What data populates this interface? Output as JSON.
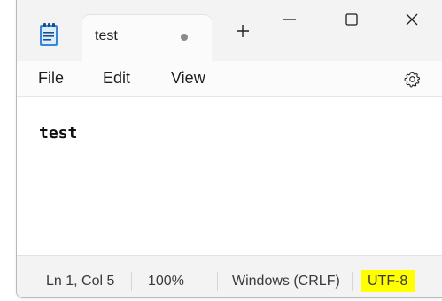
{
  "app": {
    "tab_title": "test",
    "tab_unsaved_indicator": "dot",
    "icon": "notepad-icon",
    "accent_color": "#3a86d6"
  },
  "window_controls": {
    "new_tab_icon": "plus-icon",
    "minimize_icon": "minimize-icon",
    "maximize_icon": "maximize-icon",
    "close_icon": "close-icon"
  },
  "menu": {
    "file": "File",
    "edit": "Edit",
    "view": "View",
    "settings_icon": "gear-icon"
  },
  "editor": {
    "content": "test"
  },
  "status": {
    "position": "Ln 1, Col 5",
    "zoom": "100%",
    "line_ending": "Windows (CRLF)",
    "encoding": "UTF-8",
    "encoding_highlight_color": "#ffff00"
  }
}
